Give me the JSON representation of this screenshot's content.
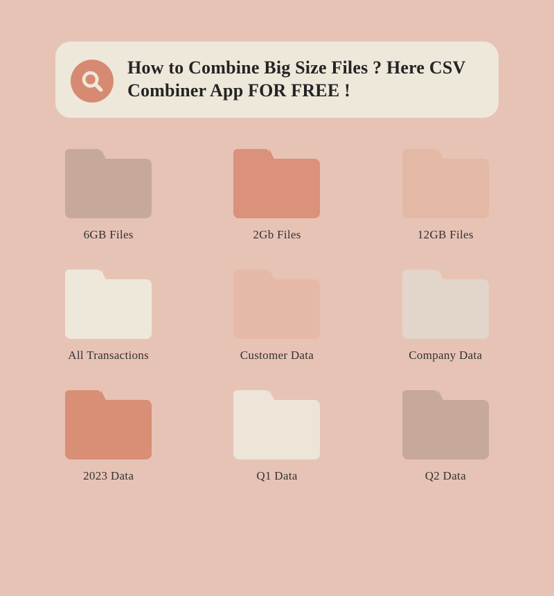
{
  "banner": {
    "headline": "How to Combine Big Size Files  ? Here CSV Combiner App FOR FREE !",
    "icon_accent": "#d68a71",
    "icon_fg": "#eee8db"
  },
  "folders": [
    {
      "label": "6GB Files",
      "color": "#c7a99b"
    },
    {
      "label": "2Gb Files",
      "color": "#da927a"
    },
    {
      "label": "12GB Files",
      "color": "#e3b9a6"
    },
    {
      "label": "All Transactions",
      "color": "#eee8db"
    },
    {
      "label": "Customer Data",
      "color": "#e5b9a6"
    },
    {
      "label": "Company Data",
      "color": "#e2d5c9"
    },
    {
      "label": "2023 Data",
      "color": "#d98e76"
    },
    {
      "label": "Q1 Data",
      "color": "#ece5d8"
    },
    {
      "label": "Q2 Data",
      "color": "#c7a99b"
    }
  ],
  "background": "#e7c3b6"
}
